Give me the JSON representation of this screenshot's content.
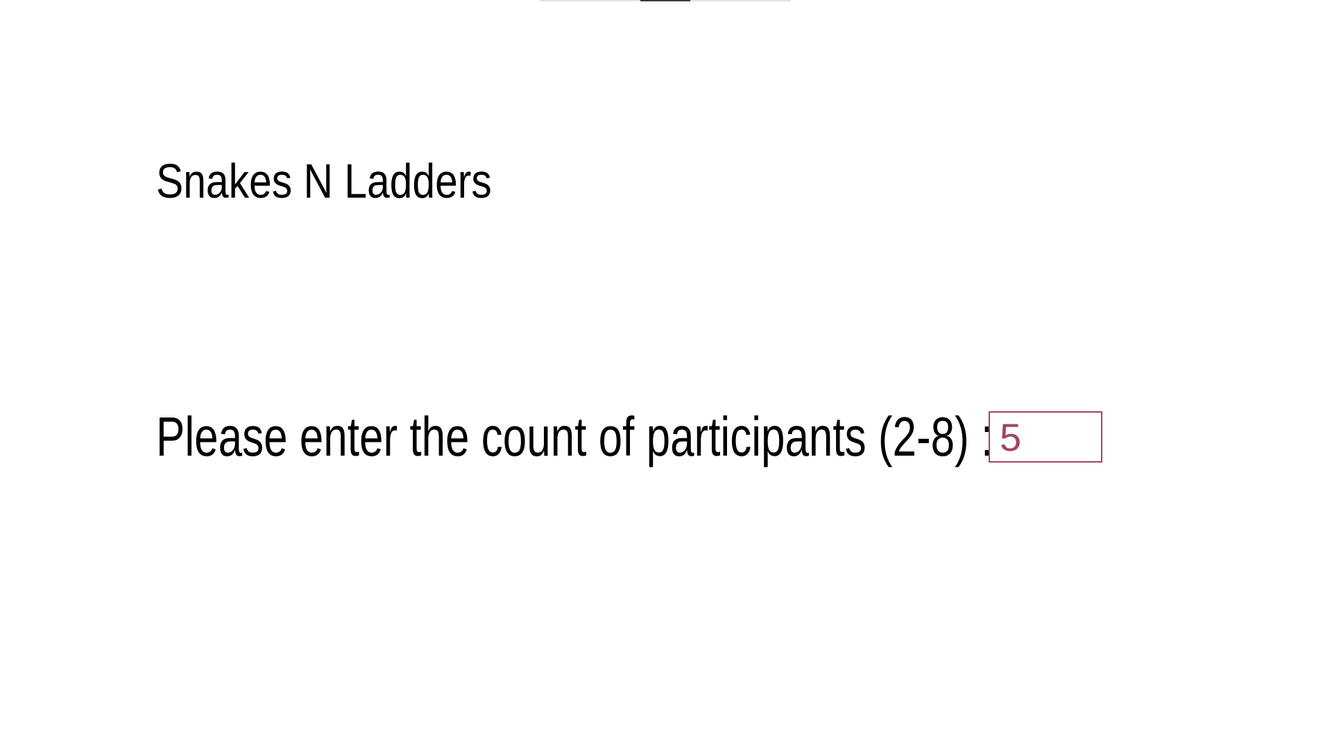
{
  "header": {
    "title": "Snakes N Ladders"
  },
  "form": {
    "prompt_label": "Please enter the count of participants (2-8) :",
    "participant_count_value": "5"
  },
  "colors": {
    "input_accent": "#a3435f"
  }
}
